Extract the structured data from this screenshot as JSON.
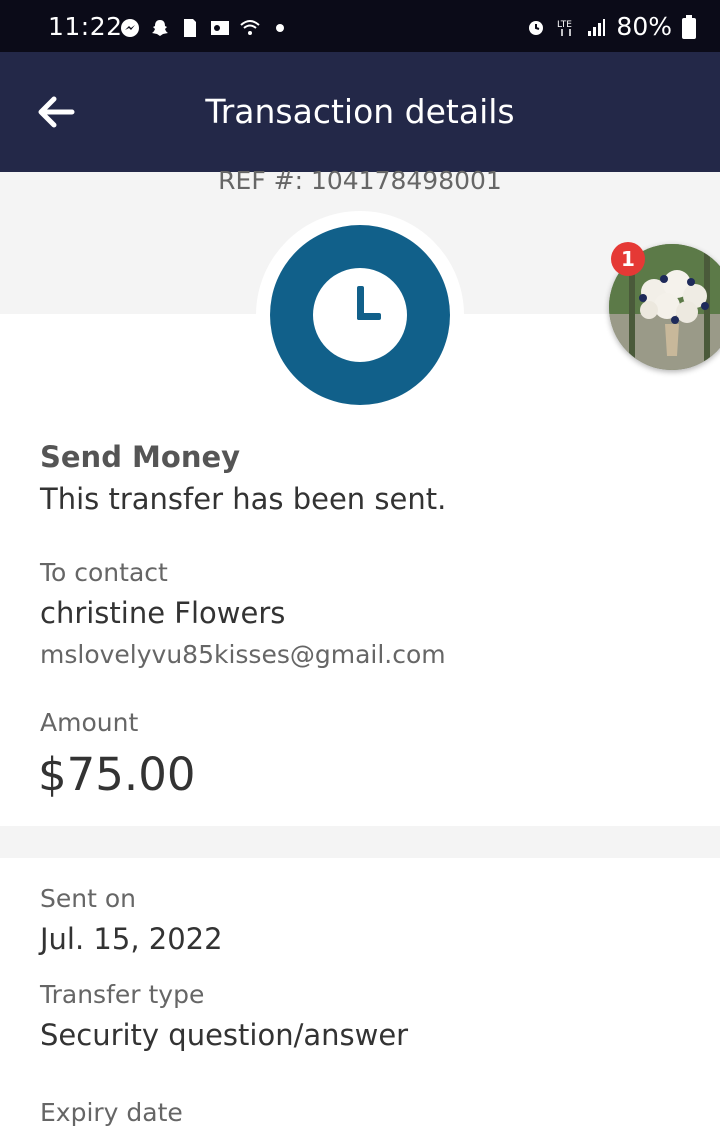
{
  "status_bar": {
    "time": "11:22",
    "left_icons": [
      "messenger-icon",
      "snapchat-icon",
      "sim-icon",
      "outlook-icon",
      "wifi-icon",
      "dot-icon"
    ],
    "right_icons": [
      "alarm-icon",
      "lte-icon",
      "signal-icon"
    ],
    "battery": "80%"
  },
  "app_bar": {
    "title": "Transaction details",
    "back_icon": "back-arrow-icon"
  },
  "reference": "REF #: 104178498001",
  "status_icon": "clock-icon",
  "chat_head": {
    "badge_count": "1"
  },
  "transfer": {
    "section_title": "Send Money",
    "status_text": "This transfer has been sent."
  },
  "contact": {
    "label": "To contact",
    "name": "christine Flowers",
    "email": "mslovelyvu85kisses@gmail.com"
  },
  "amount": {
    "label": "Amount",
    "value": "$75.00"
  },
  "details": {
    "sent_on_label": "Sent on",
    "sent_on_value": "Jul. 15, 2022",
    "transfer_type_label": "Transfer type",
    "transfer_type_value": "Security question/answer",
    "next_label_partial": "Expiry date"
  },
  "colors": {
    "status_bar": "#0b0b18",
    "app_bar": "#232848",
    "accent": "#11608a",
    "badge": "#e53935"
  }
}
